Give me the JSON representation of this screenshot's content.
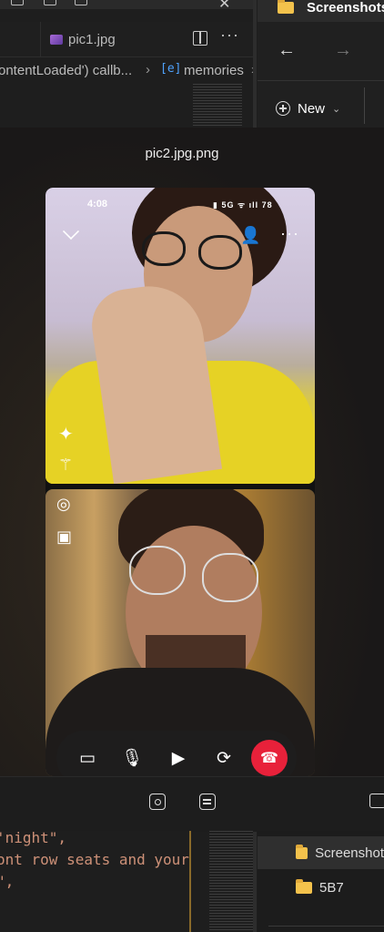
{
  "vscode": {
    "tab_label": "pic1.jpg",
    "breadcrumb_left": "ontentLoaded') callb...",
    "breadcrumb_symbol": "memories",
    "code_lines": [
      "'night\",",
      "ont row seats and your",
      "\",",
      ""
    ]
  },
  "explorer": {
    "title": "Screenshots",
    "new_label": "New",
    "items": [
      {
        "label": "Screenshot",
        "selected": true
      },
      {
        "label": "5B7",
        "selected": false
      }
    ]
  },
  "viewer": {
    "title": "pic2.jpg.png"
  },
  "phone": {
    "status_time": "4:08",
    "status_right": "▮ 5G ᯤ ıll 78"
  },
  "colors": {
    "end_call": "#e8213a",
    "folder": "#f3c24c",
    "accent_blue": "#4fa3ff"
  },
  "icons": {
    "call_controls": [
      "video-icon",
      "mic-icon",
      "screen-share-icon",
      "flip-camera-icon",
      "end-call-icon"
    ],
    "viewer_tools": [
      "visual-search-icon",
      "text-extract-icon",
      "fullscreen-icon"
    ]
  }
}
